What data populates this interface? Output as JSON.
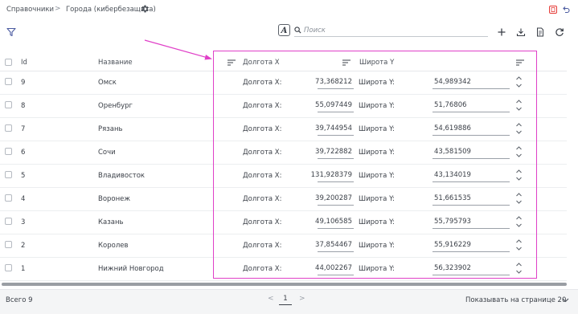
{
  "breadcrumb": {
    "root": "Справочники",
    "separator": ">",
    "current": "Города (кибербезащита)"
  },
  "search": {
    "placeholder": "Поиск",
    "value": ""
  },
  "font_button": "A",
  "columns": {
    "id": "Id",
    "name": "Название",
    "lon": "Долгота X",
    "lat": "Широта Y"
  },
  "row_labels": {
    "lon": "Долгота X:",
    "lat": "Широта Y:"
  },
  "rows": [
    {
      "id": "9",
      "name": "Омск",
      "lon": "73,368212",
      "lat": "54,989342"
    },
    {
      "id": "8",
      "name": "Оренбург",
      "lon": "55,097449",
      "lat": "51,76806"
    },
    {
      "id": "7",
      "name": "Рязань",
      "lon": "39,744954",
      "lat": "54,619886"
    },
    {
      "id": "6",
      "name": "Сочи",
      "lon": "39,722882",
      "lat": "43,581509"
    },
    {
      "id": "5",
      "name": "Владивосток",
      "lon": "131,928379",
      "lat": "43,134019"
    },
    {
      "id": "4",
      "name": "Воронеж",
      "lon": "39,200287",
      "lat": "51,661535"
    },
    {
      "id": "3",
      "name": "Казань",
      "lon": "49,106585",
      "lat": "55,795793"
    },
    {
      "id": "2",
      "name": "Королев",
      "lon": "37,854467",
      "lat": "55,916229"
    },
    {
      "id": "1",
      "name": "Нижний Новгород",
      "lon": "44,002267",
      "lat": "56,323902"
    }
  ],
  "footer": {
    "total": "Всего 9",
    "prev": "<",
    "page": "1",
    "next": ">",
    "per_page": "Показывать на странице 20"
  },
  "colors": {
    "accent": "#e040c8",
    "text": "#3a3f47",
    "pdf_red": "#e53935"
  }
}
